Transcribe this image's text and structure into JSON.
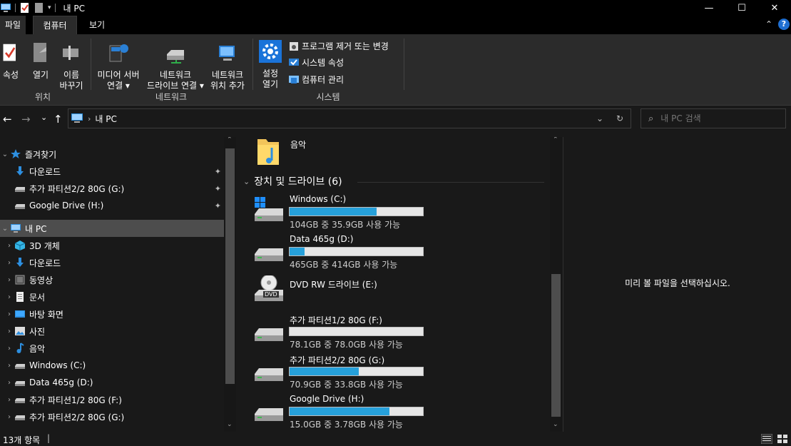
{
  "window": {
    "title": "내 PC",
    "minimize": "—",
    "maximize": "☐",
    "close": "✕"
  },
  "tabs": {
    "file": "파일",
    "computer": "컴퓨터",
    "view": "보기",
    "collapse": "⌃",
    "help": "?"
  },
  "ribbon": {
    "properties": "속성",
    "open": "열기",
    "rename_1": "이름",
    "rename_2": "바꾸기",
    "group_location": "위치",
    "media_server_1": "미디어 서버",
    "media_server_2": "연결 ▾",
    "map_drive_1": "네트워크",
    "map_drive_2": "드라이브 연결 ▾",
    "add_location_1": "네트워크",
    "add_location_2": "위치 추가",
    "group_network": "네트워크",
    "settings_1": "설정",
    "settings_2": "열기",
    "uninstall": "프로그램 제거 또는 변경",
    "system_props": "시스템 속성",
    "manage": "컴퓨터 관리",
    "group_system": "시스템"
  },
  "address": {
    "back": "←",
    "forward": "→",
    "recent": "⌄",
    "up": "↑",
    "separator": "›",
    "path": "내 PC",
    "dropdown": "⌄",
    "refresh": "↻",
    "search_placeholder": "내 PC 검색",
    "search_icon": "⌕"
  },
  "nav": {
    "quick_access": "즐겨찾기",
    "qa_downloads": "다운로드",
    "qa_partition": "추가 파티션2/2 80G (G:)",
    "qa_gdrive": "Google Drive (H:)",
    "this_pc": "내 PC",
    "objects3d": "3D 개체",
    "downloads": "다운로드",
    "videos": "동영상",
    "documents": "문서",
    "desktop": "바탕 화면",
    "pictures": "사진",
    "music": "음악",
    "windows_c": "Windows (C:)",
    "data_d": "Data 465g (D:)",
    "part_f": "추가 파티션1/2 80G (F:)",
    "part_g": "추가 파티션2/2 80G (G:)",
    "expand": "›",
    "collapse": "⌄",
    "pin": "✦",
    "scroll_up": "⌃",
    "scroll_down": "⌄"
  },
  "content": {
    "music_folder": "음악",
    "section_title": "장치 및 드라이브 (6)",
    "section_toggle": "⌄",
    "drives": [
      {
        "name": "Windows (C:)",
        "size": "104GB 중 35.9GB 사용 가능",
        "used_percent": 65
      },
      {
        "name": "Data 465g (D:)",
        "size": "465GB 중 414GB 사용 가능",
        "used_percent": 11
      },
      {
        "name": "DVD RW 드라이브 (E:)"
      },
      {
        "name": "추가 파티션1/2 80G (F:)",
        "size": "78.1GB 중 78.0GB 사용 가능",
        "used_percent": 0
      },
      {
        "name": "추가 파티션2/2 80G (G:)",
        "size": "70.9GB 중 33.8GB 사용 가능",
        "used_percent": 52
      },
      {
        "name": "Google Drive (H:)",
        "size": "15.0GB 중 3.78GB 사용 가능",
        "used_percent": 75
      }
    ],
    "dvd_label": "DVD",
    "scroll_up": "⌃",
    "scroll_down": "⌄"
  },
  "preview": {
    "message": "미리 볼 파일을 선택하십시오."
  },
  "status": {
    "count": "13개 항목",
    "cursor": "|"
  }
}
